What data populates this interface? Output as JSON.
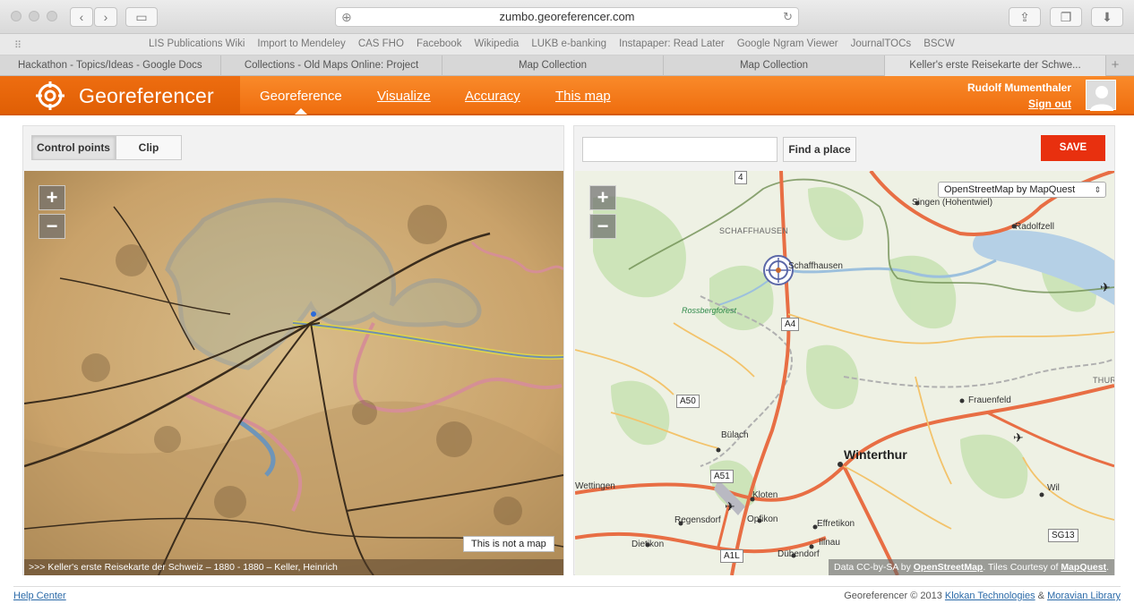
{
  "browser": {
    "url": "zumbo.georeferencer.com",
    "bookmarks": [
      "LIS Publications Wiki",
      "Import to Mendeley",
      "CAS FHO",
      "Facebook",
      "Wikipedia",
      "LUKB e-banking",
      "Instapaper: Read Later",
      "Google Ngram Viewer",
      "JournalTOCs",
      "BSCW"
    ],
    "tabs": [
      "Hackathon - Topics/Ideas - Google Docs",
      "Collections - Old Maps Online: Project",
      "Map Collection",
      "Map Collection",
      "Keller's erste Reisekarte der Schwe..."
    ]
  },
  "header": {
    "app_name": "Georeferencer",
    "nav": [
      "Georeference",
      "Visualize",
      "Accuracy",
      "This map"
    ],
    "user_name": "Rudolf Mumenthaler",
    "sign_out": "Sign out"
  },
  "left_panel": {
    "control_points": "Control points",
    "clip": "Clip",
    "zoom_in": "+",
    "zoom_out": "−",
    "not_a_map": "This is not a map",
    "attribution": ">>> Keller's erste Reisekarte der Schweiz – 1880 - 1880 – Keller, Heinrich"
  },
  "right_panel": {
    "search_placeholder": "",
    "find_place": "Find a place",
    "save": "SAVE",
    "layer": "OpenStreetMap by MapQuest",
    "zoom_in": "+",
    "zoom_out": "−",
    "attribution_prefix": "Data CC-by-SA by",
    "attribution_osm": "OpenStreetMap",
    "attribution_mid": ". Tiles Courtesy of",
    "attribution_mq": "MapQuest",
    "places": {
      "schaffhausen_region": "SCHAFFHAUSEN",
      "schaffhausen": "Schaffhausen",
      "singen": "Singen (Hohentwiel)",
      "radolfzell": "Radolfzell",
      "rossbergforest": "Rossbergforest",
      "frauenfeld": "Frauenfeld",
      "thur": "THUR",
      "bulach": "Bülach",
      "winterthur": "Winterthur",
      "wettingen": "Wettingen",
      "kloten": "Kloten",
      "regensdorf": "Regensdorf",
      "opfikon": "Opfikon",
      "effretikon": "Effretikon",
      "illnau": "Illnau",
      "dietikon": "Dietikon",
      "dubendorf": "Dübendorf",
      "wil": "Wil"
    },
    "shields": {
      "s4": "4",
      "a4": "A4",
      "a50": "A50",
      "a51": "A51",
      "a1l": "A1L",
      "sg13": "SG13"
    }
  },
  "footer": {
    "help": "Help Center",
    "copyright": "Georeferencer © 2013",
    "klokan": "Klokan Technologies",
    "amp": "&",
    "moravian": "Moravian Library"
  }
}
